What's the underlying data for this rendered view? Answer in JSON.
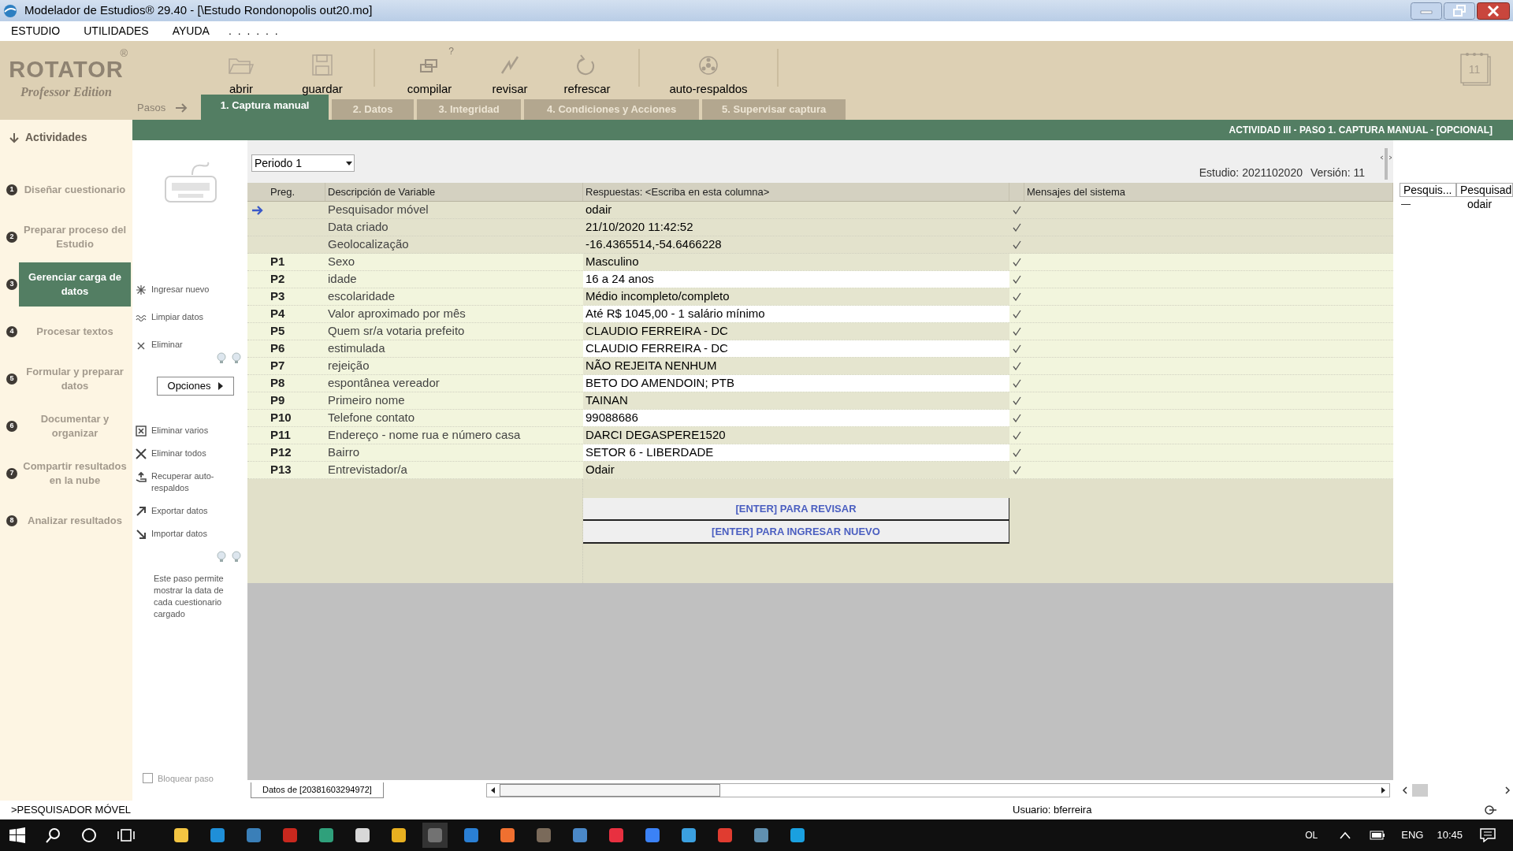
{
  "window": {
    "title": "Modelador de Estudios® 29.40 - [\\Estudo Rondonopolis out20.mo]"
  },
  "menu": {
    "items": [
      "ESTUDIO",
      "UTILIDADES",
      "AYUDA"
    ],
    "dots": ". . . . . ."
  },
  "logo": {
    "name": "ROTATOR",
    "edition": "Professor Edition",
    "mark": "®"
  },
  "toolbar": [
    {
      "kind": "folder",
      "label": "abrir",
      "sep": false
    },
    {
      "kind": "save",
      "label": "guardar",
      "sep": true
    },
    {
      "kind": "compile",
      "label": "compilar",
      "help": "?",
      "sep": false
    },
    {
      "kind": "check",
      "label": "revisar",
      "sep": false
    },
    {
      "kind": "refresh",
      "label": "refrescar",
      "sep": true
    },
    {
      "kind": "backup",
      "label": "auto-respaldos",
      "sep": true
    }
  ],
  "calendar": {
    "day": "11"
  },
  "steps": {
    "label": "Pasos",
    "tabs": [
      {
        "label": "1. Captura manual",
        "selected": true
      },
      {
        "label": "2. Datos",
        "selected": false
      },
      {
        "label": "3. Integridad",
        "selected": false
      },
      {
        "label": "4. Condiciones y Acciones",
        "selected": false
      },
      {
        "label": "5. Supervisar captura",
        "selected": false
      }
    ]
  },
  "banner": "ACTIVIDAD III - PASO 1. CAPTURA MANUAL - [OPCIONAL]",
  "sidebar": {
    "title": "Actividades",
    "items": [
      {
        "number": "1",
        "label": "Diseñar cuestionario",
        "selected": false
      },
      {
        "number": "2",
        "label": "Preparar proceso del Estudio",
        "selected": false
      },
      {
        "number": "3",
        "label": "Gerenciar carga de datos",
        "selected": true
      },
      {
        "number": "4",
        "label": "Procesar textos",
        "selected": false
      },
      {
        "number": "5",
        "label": "Formular y preparar datos",
        "selected": false
      },
      {
        "number": "6",
        "label": "Documentar y organizar",
        "selected": false
      },
      {
        "number": "7",
        "label": "Compartir resultados en la nube",
        "selected": false
      },
      {
        "number": "8",
        "label": "Analizar resultados",
        "selected": false
      }
    ]
  },
  "actions": {
    "top": [
      {
        "kind": "new",
        "label": "Ingresar nuevo"
      },
      {
        "kind": "clean",
        "label": "Limpiar datos"
      },
      {
        "kind": "x",
        "label": "Eliminar"
      }
    ],
    "options": "Opciones",
    "bottom": [
      {
        "kind": "xbox",
        "label": "Eliminar varios"
      },
      {
        "kind": "bigx",
        "label": "Eliminar todos"
      },
      {
        "kind": "recover",
        "label": "Recuperar auto-respaldos"
      },
      {
        "kind": "export",
        "label": "Exportar datos"
      },
      {
        "kind": "import",
        "label": "Importar datos"
      }
    ],
    "help": "Este paso permite mostrar la data de cada cuestionario cargado",
    "lock": {
      "label": "Bloquear paso",
      "checked": false
    }
  },
  "period": "Periodo 1",
  "study": {
    "estudio": "Estudio: 2021102020",
    "version": "Versión: 11"
  },
  "table": {
    "columns": [
      "Preg.",
      "Descripción de Variable",
      "Respuestas:  <Escriba en esta columna>",
      "Mensajes del sistema"
    ],
    "rows": [
      {
        "kind": "system",
        "preg": "",
        "desc": "Pesquisador móvel",
        "answer": "odair",
        "valid": true,
        "selected": true
      },
      {
        "kind": "system",
        "preg": "",
        "desc": "Data criado",
        "answer": "21/10/2020 11:42:52",
        "valid": true,
        "selected": false
      },
      {
        "kind": "system",
        "preg": "",
        "desc": "Geolocalização",
        "answer": "-16.4365514,-54.6466228",
        "valid": true,
        "selected": false
      },
      {
        "kind": "question",
        "preg": "P1",
        "desc": "Sexo",
        "answer": "Masculino",
        "valid": true,
        "selected": false
      },
      {
        "kind": "question",
        "preg": "P2",
        "desc": "idade",
        "answer": "16 a 24 anos",
        "valid": true,
        "selected": false
      },
      {
        "kind": "question",
        "preg": "P3",
        "desc": "escolaridade",
        "answer": "Médio incompleto/completo",
        "valid": true,
        "selected": false
      },
      {
        "kind": "question",
        "preg": "P4",
        "desc": "Valor aproximado por mês",
        "answer": "Até R$ 1045,00 - 1 salário mínimo",
        "valid": true,
        "selected": false
      },
      {
        "kind": "question",
        "preg": "P5",
        "desc": "Quem sr/a votaria prefeito",
        "answer": "CLAUDIO FERREIRA - DC",
        "valid": true,
        "selected": false
      },
      {
        "kind": "question",
        "preg": "P6",
        "desc": "estimulada",
        "answer": "CLAUDIO FERREIRA - DC",
        "valid": true,
        "selected": false
      },
      {
        "kind": "question",
        "preg": "P7",
        "desc": "rejeição",
        "answer": "NÃO REJEITA NENHUM",
        "valid": true,
        "selected": false
      },
      {
        "kind": "question",
        "preg": "P8",
        "desc": "espontânea vereador",
        "answer": "BETO DO AMENDOIN; PTB",
        "valid": true,
        "selected": false
      },
      {
        "kind": "question",
        "preg": "P9",
        "desc": "Primeiro nome",
        "answer": "TAINAN",
        "valid": true,
        "selected": false
      },
      {
        "kind": "question",
        "preg": "P10",
        "desc": "Telefone contato",
        "answer": "99088686",
        "valid": true,
        "selected": false
      },
      {
        "kind": "question",
        "preg": "P11",
        "desc": "Endereço - nome rua e número casa",
        "answer": "DARCI DEGASPERE1520",
        "valid": true,
        "selected": false
      },
      {
        "kind": "question",
        "preg": "P12",
        "desc": "Bairro",
        "answer": "SETOR 6 - LIBERDADE",
        "valid": true,
        "selected": false
      },
      {
        "kind": "question",
        "preg": "P13",
        "desc": "Entrevistador/a",
        "answer": "Odair",
        "valid": true,
        "selected": false
      }
    ],
    "buttons": [
      "[ENTER] PARA REVISAR",
      "[ENTER] PARA INGRESAR NUEVO"
    ]
  },
  "side_grid": {
    "columns": [
      "Pesquis...",
      "Pesquisad"
    ],
    "value": "odair"
  },
  "sheet_tab": "Datos de [20381603294972]",
  "status_bar": {
    "left": ">PESQUISADOR MÓVEL",
    "user": "Usuario: bferreira"
  },
  "taskbar": {
    "tray": [
      "OL",
      "ENG"
    ],
    "time": "10:45"
  }
}
